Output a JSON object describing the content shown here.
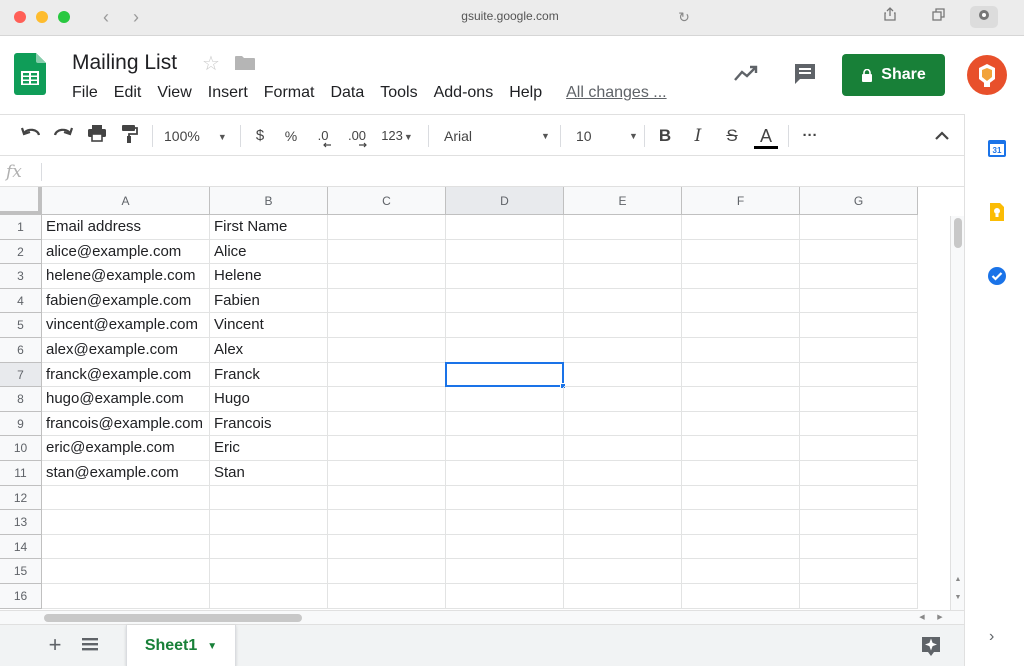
{
  "browser": {
    "url": "gsuite.google.com"
  },
  "doc": {
    "title": "Mailing List",
    "menu": [
      "File",
      "Edit",
      "View",
      "Insert",
      "Format",
      "Data",
      "Tools",
      "Add-ons",
      "Help"
    ],
    "all_changes": "All changes ...",
    "share_label": "Share"
  },
  "toolbar": {
    "zoom": "100%",
    "currency": "$",
    "percent": "%",
    "decimal_decrease": ".0",
    "decimal_increase": ".00",
    "more_formats": "123",
    "font": "Arial",
    "font_size": "10",
    "bold": "B",
    "italic": "I",
    "strikethrough": "S",
    "text_color": "A",
    "more": "···"
  },
  "formula_bar": {
    "fx": "fx",
    "value": ""
  },
  "grid": {
    "columns": [
      "A",
      "B",
      "C",
      "D",
      "E",
      "F",
      "G"
    ],
    "rows": [
      "1",
      "2",
      "3",
      "4",
      "5",
      "6",
      "7",
      "8",
      "9",
      "10",
      "11",
      "12",
      "13",
      "14",
      "15",
      "16"
    ],
    "cells": [
      [
        "Email address",
        "First Name"
      ],
      [
        "alice@example.com",
        "Alice"
      ],
      [
        "helene@example.com",
        "Helene"
      ],
      [
        "fabien@example.com",
        "Fabien"
      ],
      [
        "vincent@example.com",
        "Vincent"
      ],
      [
        "alex@example.com",
        "Alex"
      ],
      [
        "franck@example.com",
        "Franck"
      ],
      [
        "hugo@example.com",
        "Hugo"
      ],
      [
        "francois@example.com",
        "Francois"
      ],
      [
        "eric@example.com",
        "Eric"
      ],
      [
        "stan@example.com",
        "Stan"
      ]
    ],
    "selected_cell": "D7"
  },
  "tabs": {
    "sheets": [
      "Sheet1"
    ],
    "active": "Sheet1"
  },
  "side_panel": {
    "icons": [
      "calendar-icon",
      "keep-icon",
      "tasks-icon"
    ]
  },
  "colors": {
    "brand_green": "#188038",
    "selection_blue": "#1a73e8",
    "avatar": "#e8502b"
  }
}
